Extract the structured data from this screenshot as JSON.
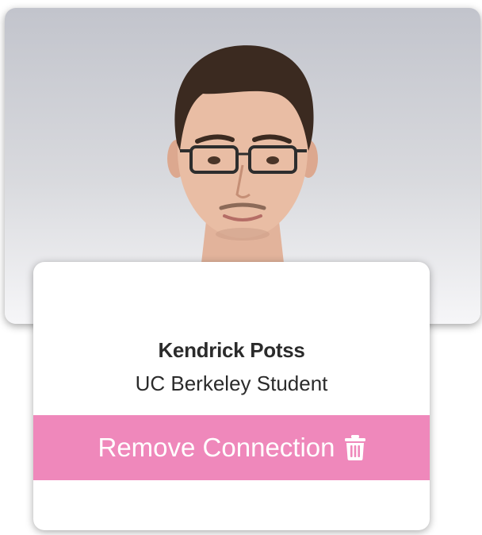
{
  "profile": {
    "name": "Kendrick Potss",
    "subtitle": "UC Berkeley Student",
    "remove_label": "Remove Connection",
    "remove_icon": "trash-icon",
    "photo": "profile-photo"
  },
  "colors": {
    "accent": "#ef88bb",
    "text": "#2b2b2b",
    "button_text": "#ffffff"
  }
}
